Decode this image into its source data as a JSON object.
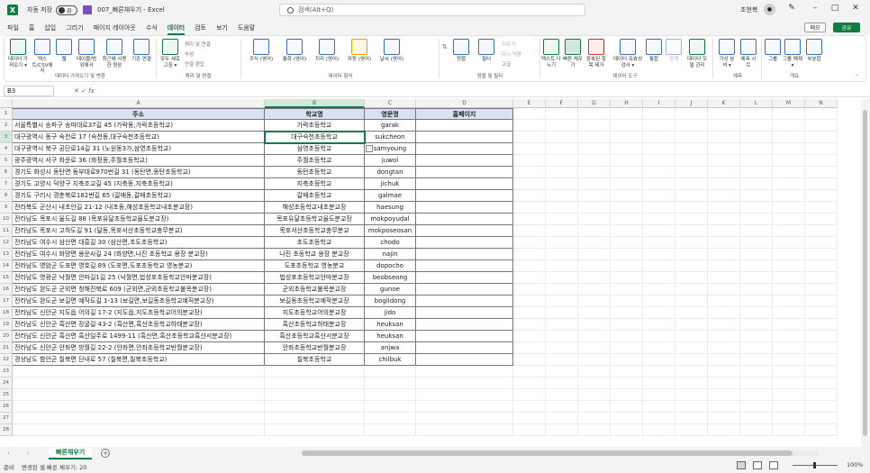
{
  "app": {
    "autosave_label": "자동 저장",
    "autosave_state": "끔",
    "doc_title": "007_빠른채우기 - Excel",
    "search_placeholder": "검색(Alt+Q)",
    "user_name": "조현복",
    "memo_label": "메모",
    "share_label": "공유"
  },
  "menu": [
    "파일",
    "홈",
    "삽입",
    "그리기",
    "페이지 레이아웃",
    "수식",
    "데이터",
    "검토",
    "보기",
    "도움말"
  ],
  "active_menu": "데이터",
  "ribbon": {
    "get_data": "데이터 가져오기 ▾",
    "text_csv": "텍스트/CSV에서",
    "web": "웹",
    "table_range": "테이블/범위에서",
    "recent_sources": "최근에 사용한 원본",
    "existing_conn": "기존 연결",
    "group1": "데이터 가져오기 및 변환",
    "refresh_all": "모두 새로 고침 ▾",
    "queries_conn": "쿼리 및 연결",
    "properties": "속성",
    "edit_links": "연결 편집",
    "group2": "쿼리 및 연결",
    "stocks": "주식 (영어)",
    "currencies": "통화 (영어)",
    "geography": "지리 (영어)",
    "auto": "자동 (영어)",
    "weather": "날씨 (영어)",
    "group3": "데이터 형식",
    "sort": "정렬",
    "filter": "필터",
    "clear": "지우기",
    "reapply": "다시 적용",
    "advanced": "고급",
    "group4": "정렬 및 필터",
    "text_to_columns": "텍스트 나누기",
    "flash_fill": "빠른 채우기",
    "remove_dup": "중복된 항목 제거",
    "data_validation": "데이터 유효성 검사 ▾",
    "consolidate": "통합",
    "relationships": "관계",
    "data_model": "데이터 모델 관리",
    "group5": "데이터 도구",
    "what_if": "가상 분석 ▾",
    "forecast": "예측 시트",
    "group6": "예측",
    "group_btn": "그룹",
    "ungroup": "그룹 해제 ▾",
    "subtotal": "부분합",
    "group7": "개요"
  },
  "formula_bar": {
    "name_box": "B3",
    "formula": ""
  },
  "columns": [
    "A",
    "B",
    "C",
    "D",
    "E",
    "F",
    "G",
    "H",
    "I",
    "J",
    "K",
    "L",
    "M",
    "N"
  ],
  "table": {
    "headers": [
      "주소",
      "학교명",
      "영문명",
      "홈페이지"
    ],
    "rows": [
      [
        "서울특별시 송파구 송파대로37길 45 (가락동,가락초등학교)",
        "가락초등학교",
        "garak"
      ],
      [
        "대구광역시 동구 숙천로 17 (숙천동,대구숙천초등학교)",
        "대구숙천초등학교",
        "sukcheon"
      ],
      [
        "대구광역시 북구 공단로14길 31 (노원동3가,삼영초등학교)",
        "삼영초등학교",
        "samyoung"
      ],
      [
        "광주광역시 서구 화운로 36 (화정동,주월초등학교)",
        "주월초등학교",
        "juwol"
      ],
      [
        "경기도 화성시 동탄면 동부대로970번길 31 (동탄면,동탄초등학교)",
        "동탄초등학교",
        "dongtan"
      ],
      [
        "경기도 고양시 덕양구 지축조교길 45 (지축동,지축초등학교)",
        "지축초등학교",
        "jichuk"
      ],
      [
        "경기도 구리시 경춘북로182번길 65 (갈매동,갈매초등학교)",
        "갈매초등학교",
        "galmae"
      ],
      [
        "전라북도 군산시 내초안길 21-12 (내초동,해성초등학교내초분교장)",
        "해성초등학교내초분교장",
        "haesung"
      ],
      [
        "전라남도 목포시 율도길 88 (목포유달초등학교율도분교장)",
        "목포유달초등학교율도분교장",
        "mokpoyudal"
      ],
      [
        "전라남도 목포시 고하도길 91 (달동,목포서산초등학교충무분교)",
        "목포서산초등학교충무분교",
        "mokposeosan"
      ],
      [
        "전라남도 여수시 삼산면 대흥길 30 (삼산면,초도초등학교)",
        "초도초등학교",
        "chodo"
      ],
      [
        "전라남도 여수시 화양면 용운사길 24 (화양면,나진 초등학교 용장 분교장)",
        "나진 초등학교 용장 분교장",
        "najin"
      ],
      [
        "전라남도 영암군 도포면 영호길 89 (도포면,도포초등학교 영농분교)",
        "도포초등학교 영농분교",
        "dopocho"
      ],
      [
        "전라남도 영광군 낙월면 안마길1길 25 (낙월면,법성포초등학교안마분교장)",
        "법성포초등학교안마분교장",
        "beobseong"
      ],
      [
        "전라남도 완도군 군외면 청해진북로 609 (군외면,군외초등학교불목분교장)",
        "군외초등학교불목분교장",
        "gunoe"
      ],
      [
        "전라남도 완도군 보길면 예작도길 1-13 (보길면,보길동초등학교예작분교장)",
        "보길동초등학교예작분교장",
        "bogildong"
      ],
      [
        "전라남도 신안군 지도읍 어의길 17-2 (지도읍,지도초등학교어의분교장)",
        "지도초등학교어의분교장",
        "jido"
      ],
      [
        "전라남도 신안군 흑산면 장굴길 43-2 (흑산면,흑산초등학교하태분교장)",
        "흑산초등학교하태분교장",
        "heuksan"
      ],
      [
        "전라남도 신안군 흑산면 흑산일주로 1499-11 (흑산면,흑산초등학교흑산서분교장)",
        "흑산초등학교흑산서분교장",
        "heuksan"
      ],
      [
        "전라남도 신안군 안좌면 방월길 22-2 (안좌면,안좌초등학교반월분교장)",
        "안좌초등학교반월분교장",
        "anjwa"
      ],
      [
        "경상남도 함안군 칠북면 단내로 57 (칠북면,칠북초등학교)",
        "칠북초등학교",
        "chilbuk"
      ]
    ]
  },
  "row_count": 28,
  "sheet_tab": "빠른채우기",
  "status": {
    "ready": "준비",
    "message": "변경된 셀 빠른 채우기: 20",
    "zoom": "100%"
  }
}
